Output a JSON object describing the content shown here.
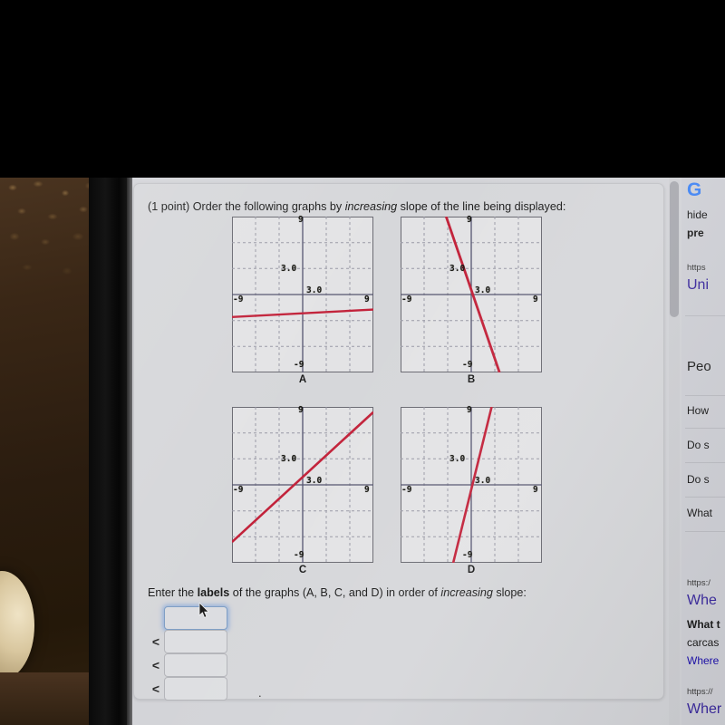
{
  "meta": {
    "capture_type": "photo-of-laptop-screen"
  },
  "homework": {
    "question_prefix": "(1 point) Order the following graphs by ",
    "question_italic": "increasing",
    "question_suffix": " slope of the line being displayed:",
    "instruction_part1": "Enter the ",
    "instruction_bold": "labels",
    "instruction_part2": " of the graphs (A, B, C, and D) in order of ",
    "instruction_italic": "increasing",
    "instruction_part3": " slope:",
    "trailing_period": ".",
    "less_than": "<",
    "answer_inputs": [
      {
        "name": "answer-box-1",
        "value": "",
        "focused": true
      },
      {
        "name": "answer-box-2",
        "value": "",
        "focused": false
      },
      {
        "name": "answer-box-3",
        "value": "",
        "focused": false
      },
      {
        "name": "answer-box-4",
        "value": "",
        "focused": false
      }
    ],
    "line_color": "#c2223a",
    "axis_color": "#4a4a66",
    "grid_color": "#9a9aa6",
    "plot_bg": "#e3e3e5"
  },
  "chart_data": [
    {
      "type": "line",
      "title": "A",
      "xlabel": "",
      "ylabel": "",
      "xlim": [
        -9,
        9
      ],
      "ylim": [
        -9,
        9
      ],
      "xticks": [
        -9,
        3,
        9
      ],
      "yticks": [
        -9,
        3,
        9
      ],
      "xtick_labels": [
        "-9",
        "3.0",
        "9"
      ],
      "ytick_labels": [
        "-9",
        "3.0",
        "9"
      ],
      "grid": true,
      "grid_dashed_at": [
        -6,
        -3,
        3,
        6
      ],
      "series": [
        {
          "name": "line-a",
          "x": [
            -9,
            9
          ],
          "y": [
            -2.6,
            -0.9
          ],
          "slope": 0.09,
          "intercept": -1.75,
          "color": "#c2223a"
        }
      ]
    },
    {
      "type": "line",
      "title": "B",
      "xlabel": "",
      "ylabel": "",
      "xlim": [
        -9,
        9
      ],
      "ylim": [
        -9,
        9
      ],
      "xticks": [
        -9,
        3,
        9
      ],
      "yticks": [
        -9,
        3,
        9
      ],
      "xtick_labels": [
        "-9",
        "3.0",
        "9"
      ],
      "ytick_labels": [
        "-9",
        "3.0",
        "9"
      ],
      "grid": true,
      "grid_dashed_at": [
        -6,
        -3,
        3,
        6
      ],
      "series": [
        {
          "name": "line-b",
          "x": [
            -3.2,
            3.6
          ],
          "y": [
            9,
            -9
          ],
          "slope": -2.65,
          "intercept": 0.5,
          "color": "#c2223a"
        }
      ]
    },
    {
      "type": "line",
      "title": "C",
      "xlabel": "",
      "ylabel": "",
      "xlim": [
        -9,
        9
      ],
      "ylim": [
        -9,
        9
      ],
      "xticks": [
        -9,
        3,
        9
      ],
      "yticks": [
        -9,
        3,
        9
      ],
      "xtick_labels": [
        "-9",
        "3.0",
        "9"
      ],
      "ytick_labels": [
        "-9",
        "3.0",
        "9"
      ],
      "grid": true,
      "grid_dashed_at": [
        -6,
        -3,
        3,
        6
      ],
      "series": [
        {
          "name": "line-c",
          "x": [
            -9,
            9
          ],
          "y": [
            -6.6,
            8.4
          ],
          "slope": 0.83,
          "intercept": 0.9,
          "color": "#c2223a"
        }
      ]
    },
    {
      "type": "line",
      "title": "D",
      "xlabel": "",
      "ylabel": "",
      "xlim": [
        -9,
        9
      ],
      "ylim": [
        -9,
        9
      ],
      "xticks": [
        -9,
        3,
        9
      ],
      "yticks": [
        -9,
        3,
        9
      ],
      "xtick_labels": [
        "-9",
        "3.0",
        "9"
      ],
      "ytick_labels": [
        "-9",
        "3.0",
        "9"
      ],
      "grid": true,
      "grid_dashed_at": [
        -6,
        -3,
        3,
        6
      ],
      "series": [
        {
          "name": "line-d",
          "x": [
            -2.3,
            2.6
          ],
          "y": [
            -9,
            9
          ],
          "slope": 3.67,
          "intercept": -0.55,
          "color": "#c2223a"
        }
      ]
    }
  ],
  "sidebar": {
    "logo": "G",
    "items": [
      {
        "label": "hide",
        "style": "plain"
      },
      {
        "label": "pre",
        "style": "bold"
      },
      {
        "label": "https",
        "style": "url"
      },
      {
        "label": "Uni",
        "style": "head"
      },
      {
        "label": "Peo",
        "style": "big"
      },
      {
        "label": "How",
        "style": "plain"
      },
      {
        "label": "Do s",
        "style": "plain"
      },
      {
        "label": "Do s",
        "style": "plain"
      },
      {
        "label": "What",
        "style": "plain"
      },
      {
        "label": "https:/",
        "style": "url"
      },
      {
        "label": "Whe",
        "style": "head"
      },
      {
        "label": "What t",
        "style": "bold"
      },
      {
        "label": "carcas",
        "style": "plain"
      },
      {
        "label": "Where",
        "style": "link"
      },
      {
        "label": "https://",
        "style": "url"
      },
      {
        "label": "Wher",
        "style": "head"
      }
    ]
  }
}
